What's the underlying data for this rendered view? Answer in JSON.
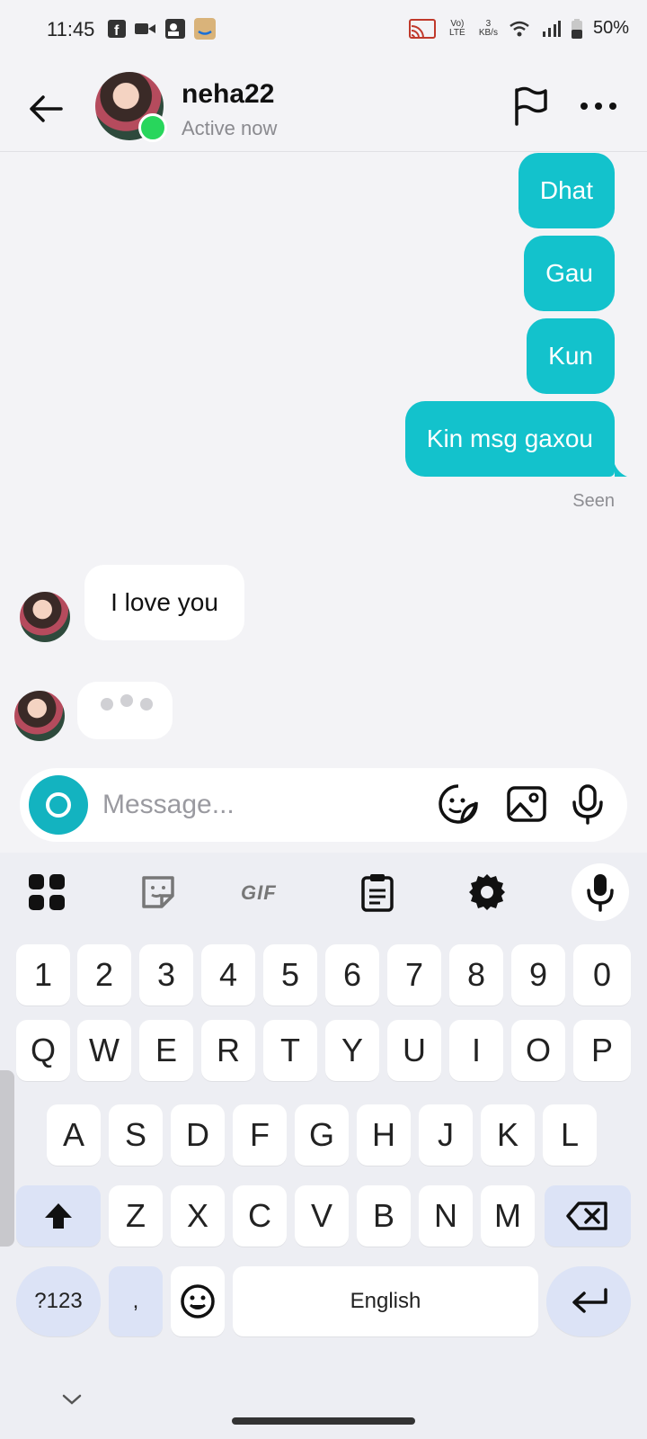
{
  "status_bar": {
    "time": "11:45",
    "network_lte": "Vo) LTE",
    "speed_value": "3",
    "speed_unit": "KB/s",
    "battery": "50%"
  },
  "header": {
    "name": "neha22",
    "status": "Active now"
  },
  "messages": {
    "outgoing": [
      "Dhat",
      "Gau",
      "Kun",
      "Kin msg gaxou"
    ],
    "seen_label": "Seen",
    "incoming": [
      "I love you"
    ]
  },
  "composer": {
    "placeholder": "Message..."
  },
  "keyboard": {
    "toolbar": {
      "gif_label": "GIF"
    },
    "row_numbers": [
      "1",
      "2",
      "3",
      "4",
      "5",
      "6",
      "7",
      "8",
      "9",
      "0"
    ],
    "row1": [
      "Q",
      "W",
      "E",
      "R",
      "T",
      "Y",
      "U",
      "I",
      "O",
      "P"
    ],
    "row2": [
      "A",
      "S",
      "D",
      "F",
      "G",
      "H",
      "J",
      "K",
      "L"
    ],
    "row3": [
      "Z",
      "X",
      "C",
      "V",
      "B",
      "N",
      "M"
    ],
    "symbols_label": "?123",
    "comma_label": ",",
    "space_label": "English"
  },
  "colors": {
    "accent": "#13c2cc",
    "online": "#28d65c"
  }
}
